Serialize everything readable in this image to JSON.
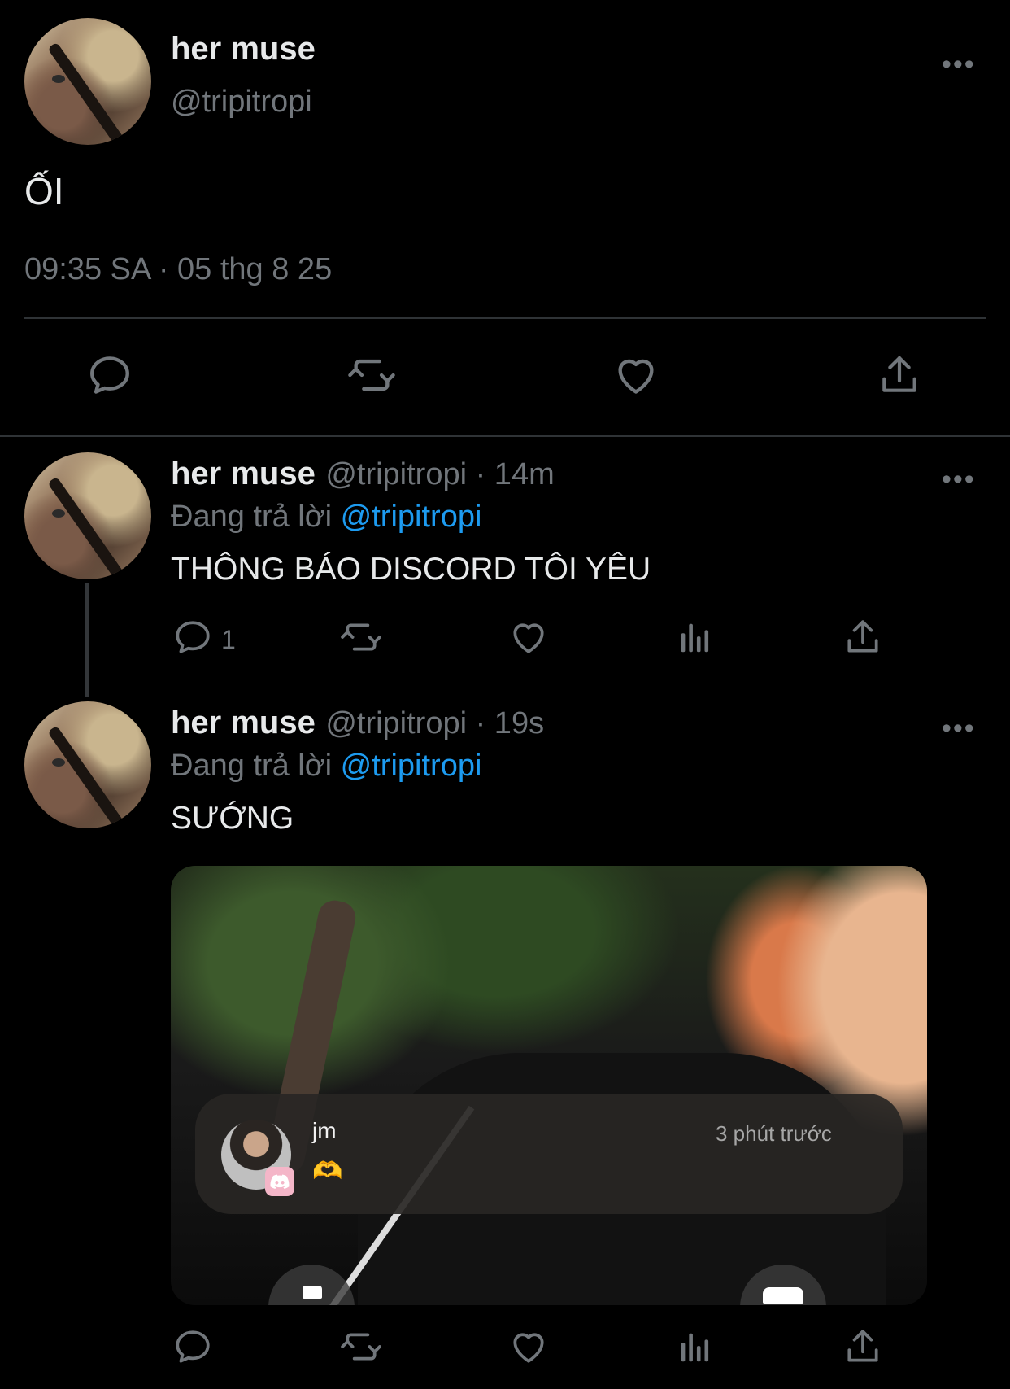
{
  "main_tweet": {
    "name": "her muse",
    "handle": "@tripitropi",
    "text": "ỐI",
    "time": "09:35 SA",
    "separator": "·",
    "date": "05 thg 8 25",
    "more_label": "•••"
  },
  "replies": [
    {
      "name": "her muse",
      "handle_meta": "@tripitropi · 14m",
      "replying_prefix": "Đang trả lời",
      "replying_to": "@tripitropi",
      "text": "THÔNG BÁO DISCORD TÔI YÊU",
      "reply_count": "1",
      "more_label": "•••"
    },
    {
      "name": "her muse",
      "handle_meta": "@tripitropi · 19s",
      "replying_prefix": "Đang trả lời",
      "replying_to": "@tripitropi",
      "text": "SƯỚNG",
      "more_label": "•••",
      "notification": {
        "sender": "jm",
        "time": "3 phút trước",
        "message": "🫶"
      }
    }
  ],
  "colors": {
    "background": "#000000",
    "text": "#e7e9ea",
    "muted": "#71767b",
    "link": "#1d9bf0",
    "divider": "#2f3336"
  }
}
